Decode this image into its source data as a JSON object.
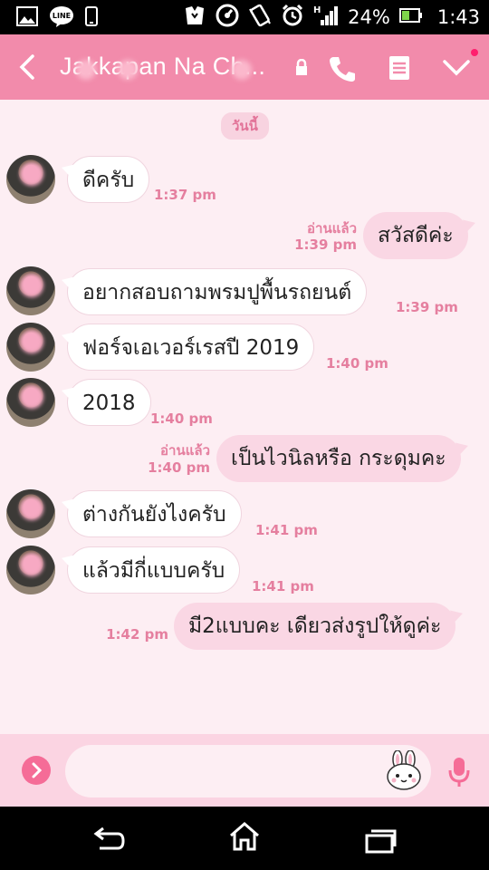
{
  "status_bar": {
    "battery_percent": "24%",
    "time": "1:43",
    "icons": [
      "gallery-icon",
      "line-icon",
      "phone-icon",
      "hanger-icon",
      "speedometer-icon",
      "vibrate-icon",
      "alarm-icon",
      "signal-icon",
      "battery-icon"
    ]
  },
  "header": {
    "title": "Jakkapan Na Ch...",
    "icons": [
      "back-icon",
      "lock-icon",
      "call-icon",
      "menu-icon",
      "chevron-down-icon"
    ],
    "accent": "#f28bab"
  },
  "chat": {
    "date_label": "วันนี้",
    "messages": [
      {
        "side": "in",
        "text": "ดีครับ",
        "time": "1:37 pm"
      },
      {
        "side": "out",
        "text": "สวัสดีค่ะ",
        "time": "1:39 pm",
        "read": "อ่านแล้ว"
      },
      {
        "side": "in",
        "text": "อยากสอบถามพรมปูพื้นรถยนต์",
        "time": "1:39 pm"
      },
      {
        "side": "in",
        "text": "ฟอร์จเอเวอร์เรสปี 2019",
        "time": "1:40 pm"
      },
      {
        "side": "in",
        "text": "2018",
        "time": "1:40 pm"
      },
      {
        "side": "out",
        "text": "เป็นไวนิลหรือ กระดุมคะ",
        "time": "1:40 pm",
        "read": "อ่านแล้ว"
      },
      {
        "side": "in",
        "text": "ต่างกันยังไงครับ",
        "time": "1:41 pm"
      },
      {
        "side": "in",
        "text": "แล้วมีกี่แบบครับ",
        "time": "1:41 pm"
      },
      {
        "side": "out",
        "text": "มี2แบบคะ เดียวส่งรูปให้ดูค่ะ",
        "time": "1:42 pm"
      }
    ]
  },
  "input_bar": {
    "placeholder": "",
    "icons": [
      "chevron-right-icon",
      "sticker-icon",
      "mic-icon"
    ]
  },
  "nav_bar": {
    "icons": [
      "back-nav-icon",
      "home-icon",
      "recent-apps-icon"
    ]
  }
}
